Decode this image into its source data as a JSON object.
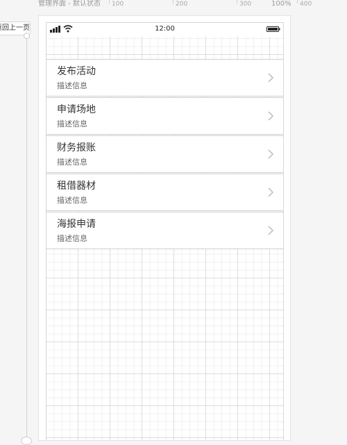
{
  "window": {
    "page_caption": "管理界面 - 默认状态",
    "zoom": "100%"
  },
  "ruler": {
    "labels": [
      "100",
      "200",
      "300",
      "400"
    ]
  },
  "back_link": {
    "label": "返回上一页"
  },
  "status_bar": {
    "time": "12:00",
    "icons": [
      "signal-icon",
      "wifi-icon",
      "battery-icon"
    ]
  },
  "menu": {
    "items": [
      {
        "title": "发布活动",
        "desc": "描述信息"
      },
      {
        "title": "申请场地",
        "desc": "描述信息"
      },
      {
        "title": "财务报账",
        "desc": "描述信息"
      },
      {
        "title": "租借器材",
        "desc": "描述信息"
      },
      {
        "title": "海报申请",
        "desc": "描述信息"
      }
    ],
    "chevron_icon": "chevron-right-icon"
  },
  "colors": {
    "background": "#f5f5f5",
    "panel": "#ffffff",
    "divider": "#cfcfcf",
    "text_primary": "#333333",
    "text_secondary": "#666666",
    "chevron": "#bbbbbb"
  }
}
